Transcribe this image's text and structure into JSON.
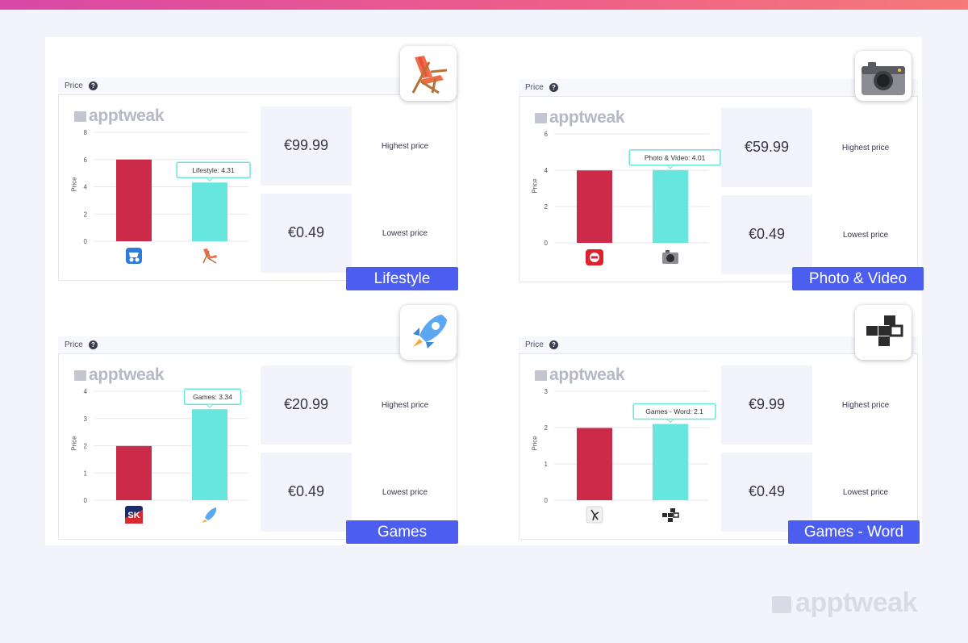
{
  "brand": "apptweak",
  "colors": {
    "competitor_bar": "#cb2a48",
    "category_bar": "#66e6dc",
    "tag_bg": "#4c5ef0",
    "gradient_start": "#d948a6",
    "gradient_end": "#f57a78"
  },
  "price_label": "Price",
  "help_glyph": "?",
  "charts": [
    {
      "category": "Lifestyle",
      "category_icon": "lounge-chair-icon",
      "highest_value": "€99.99",
      "highest_caption": "Highest price",
      "lowest_value": "€0.49",
      "lowest_caption": "Lowest price",
      "tooltip": "Lifestyle: 4.31",
      "chart_data": {
        "type": "bar",
        "ylabel": "Price",
        "ylim": [
          0,
          8
        ],
        "yticks": [
          "0",
          "2",
          "4",
          "6",
          "8"
        ],
        "categories": [
          "stroller-app-icon",
          "lounge-chair-icon"
        ],
        "values": [
          6.0,
          4.31
        ]
      }
    },
    {
      "category": "Photo & Video",
      "category_icon": "camera-icon",
      "highest_value": "€59.99",
      "highest_caption": "Highest price",
      "lowest_value": "€0.49",
      "lowest_caption": "Lowest price",
      "tooltip": "Photo & Video: 4.01",
      "chart_data": {
        "type": "bar",
        "ylabel": "Price",
        "ylim": [
          0,
          6
        ],
        "yticks": [
          "0",
          "2",
          "4",
          "6"
        ],
        "categories": [
          "red-app-icon",
          "camera-icon"
        ],
        "values": [
          3.99,
          4.01
        ]
      }
    },
    {
      "category": "Games",
      "category_icon": "rocket-icon",
      "highest_value": "€20.99",
      "highest_caption": "Highest price",
      "lowest_value": "€0.49",
      "lowest_caption": "Lowest price",
      "tooltip": "Games: 3.34",
      "chart_data": {
        "type": "bar",
        "ylabel": "Price",
        "ylim": [
          0,
          4
        ],
        "yticks": [
          "0",
          "1",
          "2",
          "3",
          "4"
        ],
        "categories": [
          "sk-app-icon",
          "rocket-icon"
        ],
        "values": [
          1.99,
          3.34
        ]
      }
    },
    {
      "category": "Games - Word",
      "category_icon": "word-blocks-icon",
      "highest_value": "€9.99",
      "highest_caption": "Highest price",
      "lowest_value": "€0.49",
      "lowest_caption": "Lowest price",
      "tooltip": "Games - Word: 2.1",
      "chart_data": {
        "type": "bar",
        "ylabel": "Price",
        "ylim": [
          0,
          3
        ],
        "yticks": [
          "0",
          "1",
          "2",
          "3"
        ],
        "categories": [
          "stick-figure-app-icon",
          "word-blocks-icon"
        ],
        "values": [
          1.99,
          2.1
        ]
      }
    }
  ]
}
